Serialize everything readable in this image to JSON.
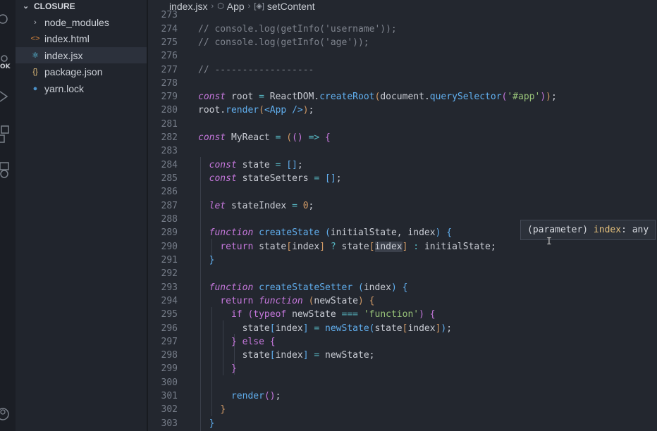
{
  "explorer": {
    "folder_name": "CLOSURE",
    "files": [
      {
        "name": "node_modules",
        "icon": "chevron-right-icon",
        "active": false
      },
      {
        "name": "index.html",
        "icon": "html-file-icon",
        "active": false
      },
      {
        "name": "index.jsx",
        "icon": "react-file-icon",
        "active": true
      },
      {
        "name": "package.json",
        "icon": "json-file-icon",
        "active": false
      },
      {
        "name": "yarn.lock",
        "icon": "yarn-file-icon",
        "active": false
      }
    ]
  },
  "activity_bar": {
    "badge_text": "OK"
  },
  "breadcrumb": {
    "file": "index.jsx",
    "component": "App",
    "symbol": "setContent"
  },
  "tooltip": {
    "prefix": "(parameter) ",
    "name": "index",
    "type_text": ": any"
  },
  "code": {
    "line_numbers": [
      "273",
      "274",
      "275",
      "276",
      "277",
      "278",
      "279",
      "280",
      "281",
      "282",
      "283",
      "284",
      "285",
      "286",
      "287",
      "288",
      "289",
      "290",
      "291",
      "292",
      "293",
      "294",
      "295",
      "296",
      "297",
      "298",
      "299",
      "300",
      "301",
      "302",
      "303"
    ]
  },
  "colors": {
    "keyword": "#c678dd",
    "function": "#61afef",
    "string": "#98c379",
    "number": "#d19a66",
    "comment": "#7f848e",
    "operator": "#56b6c2",
    "editor_bg": "#23272f",
    "sidebar_bg": "#21252d"
  }
}
